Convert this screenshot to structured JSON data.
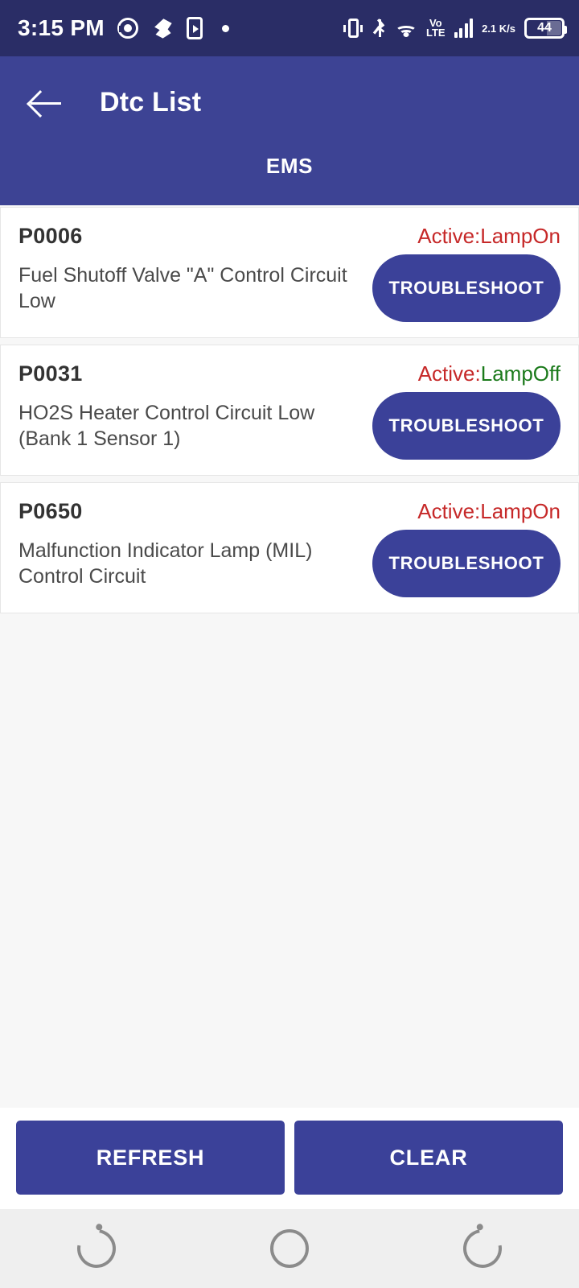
{
  "status_bar": {
    "time": "3:15 PM",
    "icons_left": [
      "cast-icon",
      "bird-app-icon",
      "media-player-icon",
      "dot-icon"
    ],
    "network_type": "Vo",
    "network_type2": "LTE",
    "data_rate_value": "2.1",
    "data_rate_unit": "K/s",
    "battery_level": "44",
    "icons_right": [
      "vibrate-icon",
      "bluetooth-icon",
      "wifi-icon",
      "volte-icon",
      "signal-bars-icon",
      "data-rate-icon",
      "battery-icon"
    ],
    "background_color": "#2a2d66"
  },
  "app_bar": {
    "back_icon": "arrow-left-icon",
    "title": "Dtc List",
    "background_color": "#3d4394",
    "tabs": [
      {
        "label": "EMS",
        "selected": true
      }
    ]
  },
  "dtc_list": [
    {
      "code": "P0006",
      "status_prefix": "Active:",
      "status_lamp": "LampOn",
      "lamp_state": "on",
      "description": "Fuel Shutoff Valve \"A\" Control Circuit Low",
      "action_label": "TROUBLESHOOT"
    },
    {
      "code": "P0031",
      "status_prefix": "Active:",
      "status_lamp": "LampOff",
      "lamp_state": "off",
      "description": "HO2S Heater Control Circuit Low (Bank 1 Sensor 1)",
      "action_label": "TROUBLESHOOT"
    },
    {
      "code": "P0650",
      "status_prefix": "Active:",
      "status_lamp": "LampOn",
      "lamp_state": "on",
      "description": "Malfunction Indicator Lamp (MIL) Control Circuit",
      "action_label": "TROUBLESHOOT"
    }
  ],
  "action_bar": {
    "refresh_label": "REFRESH",
    "clear_label": "CLEAR",
    "button_color": "#3b4199"
  },
  "nav_bar": {
    "recents_icon": "recents-icon",
    "home_icon": "home-circle-icon",
    "back_icon": "back-gesture-icon"
  },
  "colors": {
    "status_red": "#c62828",
    "status_green": "#1b7a1b",
    "accent": "#3b4199",
    "page_background": "#f7f7f7",
    "card_background": "#ffffff"
  }
}
